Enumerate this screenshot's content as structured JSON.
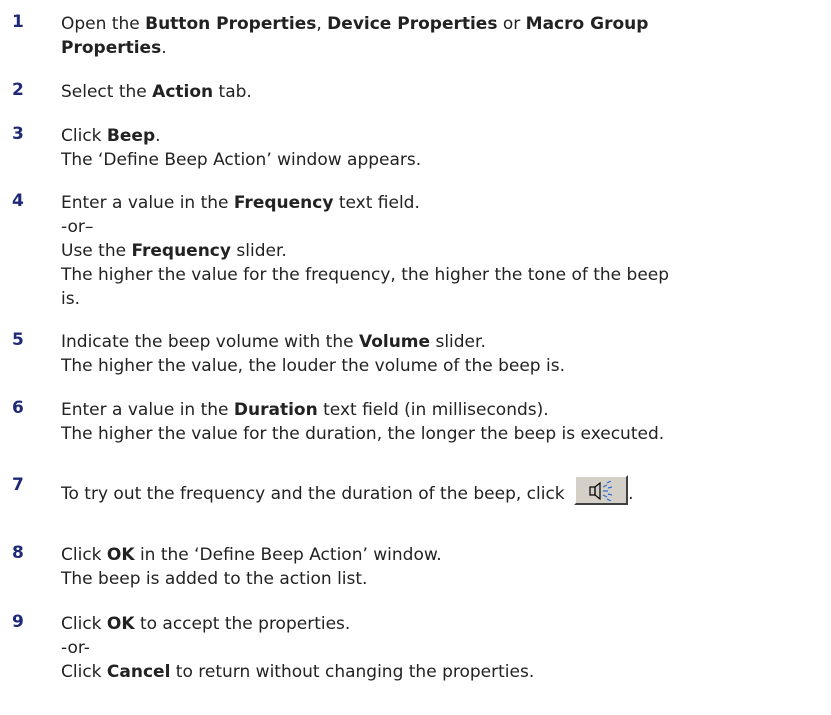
{
  "steps": [
    {
      "num": "1",
      "parts": [
        {
          "t": "Open the "
        },
        {
          "b": "Button Properties"
        },
        {
          "t": ", "
        },
        {
          "b": "Device Properties"
        },
        {
          "t": " or "
        },
        {
          "b": "Macro Group"
        }
      ],
      "line2": [
        {
          "b": "Properties"
        },
        {
          "t": "."
        }
      ]
    },
    {
      "num": "2",
      "text_a": "Select the ",
      "bold": "Action",
      "text_b": " tab."
    },
    {
      "num": "3",
      "text_a": "Click ",
      "bold": "Beep",
      "text_b": ".",
      "sub": "The ‘Define Beep Action’ window appears."
    },
    {
      "num": "4",
      "text_a": "Enter a value in the ",
      "bold": "Frequency",
      "text_b": " text field.",
      "or": "-or–",
      "alt_a": "Use the ",
      "alt_bold": "Frequency",
      "alt_b": " slider.",
      "sub": "The higher the value for the frequency, the higher the tone of the beep",
      "sub2": "is."
    },
    {
      "num": "5",
      "text_a": "Indicate the beep volume with the ",
      "bold": "Volume",
      "text_b": " slider.",
      "sub": "The higher the value, the louder the volume of the beep is."
    },
    {
      "num": "6",
      "text_a": "Enter a value in the ",
      "bold": "Duration",
      "text_b": " text field (in milliseconds).",
      "sub": "The higher the value for the duration, the longer the beep is executed."
    },
    {
      "num": "7",
      "text_a": "To try out the frequency and the duration of the beep, click ",
      "text_b": ".",
      "icon": "speaker-icon"
    },
    {
      "num": "8",
      "text_a": "Click ",
      "bold": "OK",
      "text_b": " in the ‘Define Beep Action’ window.",
      "sub": "The beep is added to the action list."
    },
    {
      "num": "9",
      "text_a": "Click ",
      "bold": "OK",
      "text_b": " to accept the properties.",
      "or": "-or-",
      "alt_a": "Click ",
      "alt_bold": "Cancel",
      "alt_b": " to return without changing the properties."
    }
  ]
}
